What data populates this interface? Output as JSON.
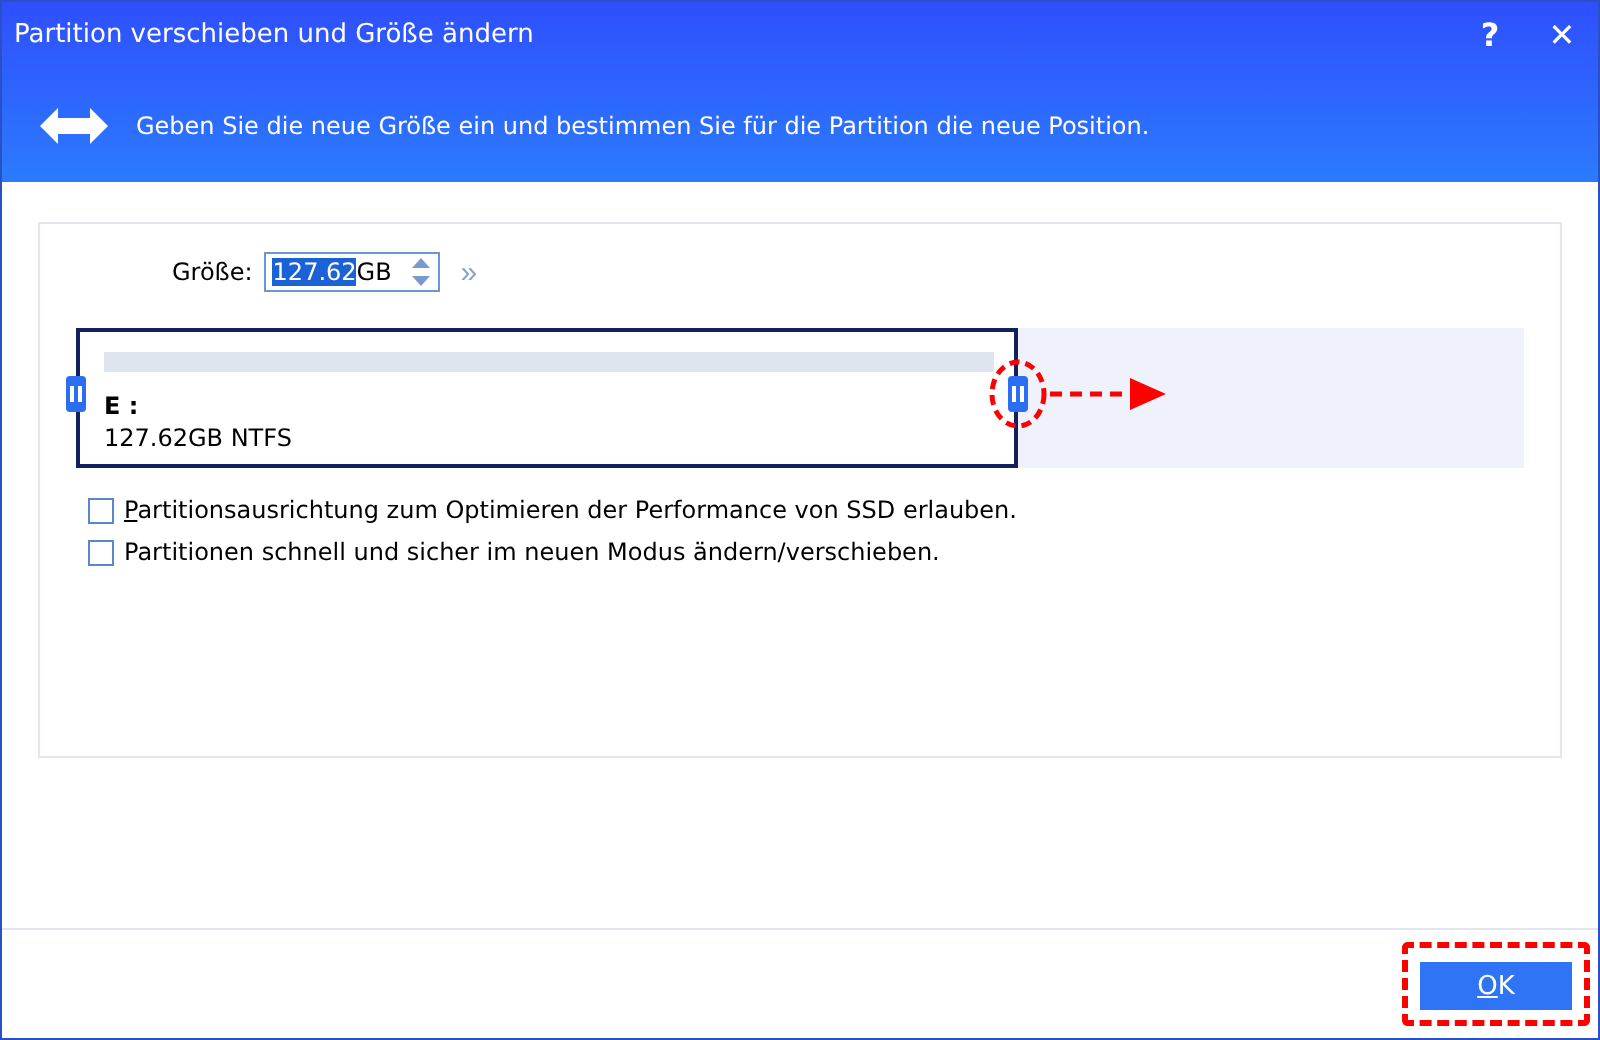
{
  "window": {
    "title": "Partition verschieben und Größe ändern",
    "help": "?",
    "close": "✕"
  },
  "header": {
    "text": "Geben Sie die neue Größe ein und bestimmen Sie für die Partition die neue Position."
  },
  "size": {
    "label": "Größe:",
    "value": "127.62",
    "unit": "GB",
    "more": "»"
  },
  "partition": {
    "drive": "E :",
    "info": "127.62GB NTFS"
  },
  "options": [
    {
      "key": "P",
      "label": "artitionsausrichtung zum Optimieren der Performance von SSD erlauben.",
      "checked": false
    },
    {
      "label": "Partitionen schnell und sicher im neuen Modus ändern/verschieben.",
      "checked": false
    }
  ],
  "buttons": [
    {
      "key": "O",
      "label": "K"
    }
  ]
}
